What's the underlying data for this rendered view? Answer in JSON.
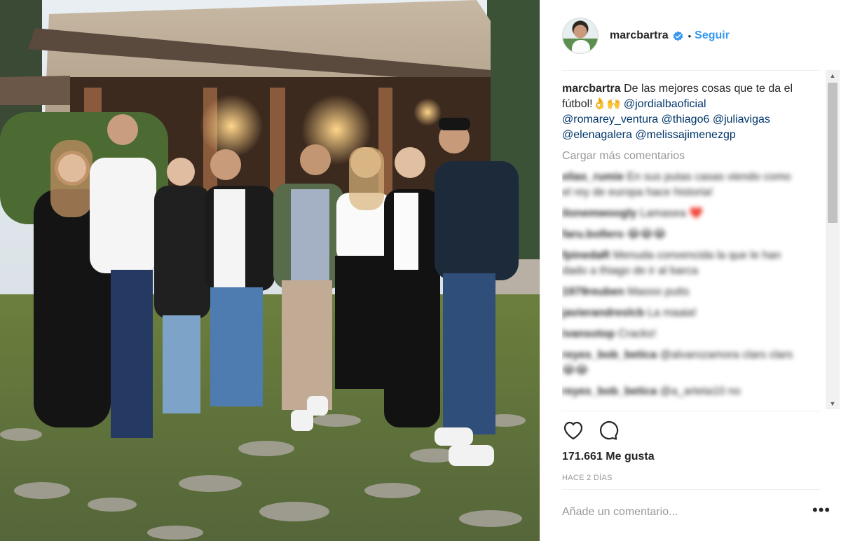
{
  "post": {
    "username": "marcbartra",
    "follow_label": "Seguir",
    "separator": "•",
    "caption": {
      "username": "marcbartra",
      "text": "De las mejores cosas que te da el fútbol!",
      "emoji": "👌🙌",
      "mentions": [
        "@jordialbaoficial",
        "@romarey_ventura",
        "@thiago6",
        "@juliavigas",
        "@elenagalera",
        "@melissajimenezgp"
      ]
    },
    "load_more_label": "Cargar más comentarios",
    "comments": [
      {
        "user": "elias_rumie",
        "text": "En sus putas casas viendo como el rey de europa hace historia!"
      },
      {
        "user": "ilonemwoogly",
        "text": "Lamasea ❤️"
      },
      {
        "user": "faru.bollero",
        "text": "😂😂😂"
      },
      {
        "user": "fpinedaR",
        "text": "Menuda convencida la que le han dado a thiago de ir al barca"
      },
      {
        "user": "1979reuben",
        "text": "Maooo putts"
      },
      {
        "user": "javierandreslcb",
        "text": "La maaia!"
      },
      {
        "user": "ivansotop",
        "text": "Cracks!"
      },
      {
        "user": "reyes_bob_betica",
        "text": "@alvarozamora clars clars 😂😂"
      },
      {
        "user": "reyes_bob_betica",
        "text": "@a_arteta10 no"
      }
    ],
    "likes_text": "171.661 Me gusta",
    "timestamp": "HACE 2 DÍAS",
    "comment_placeholder": "Añade un comentario...",
    "more_label": "•••"
  },
  "icons": {
    "verified": "verified-badge-icon",
    "like": "heart-icon",
    "comment": "comment-bubble-icon",
    "more": "more-options-icon"
  },
  "colors": {
    "link": "#3897f0",
    "mention": "#003569",
    "muted": "#999999",
    "text": "#262626"
  }
}
